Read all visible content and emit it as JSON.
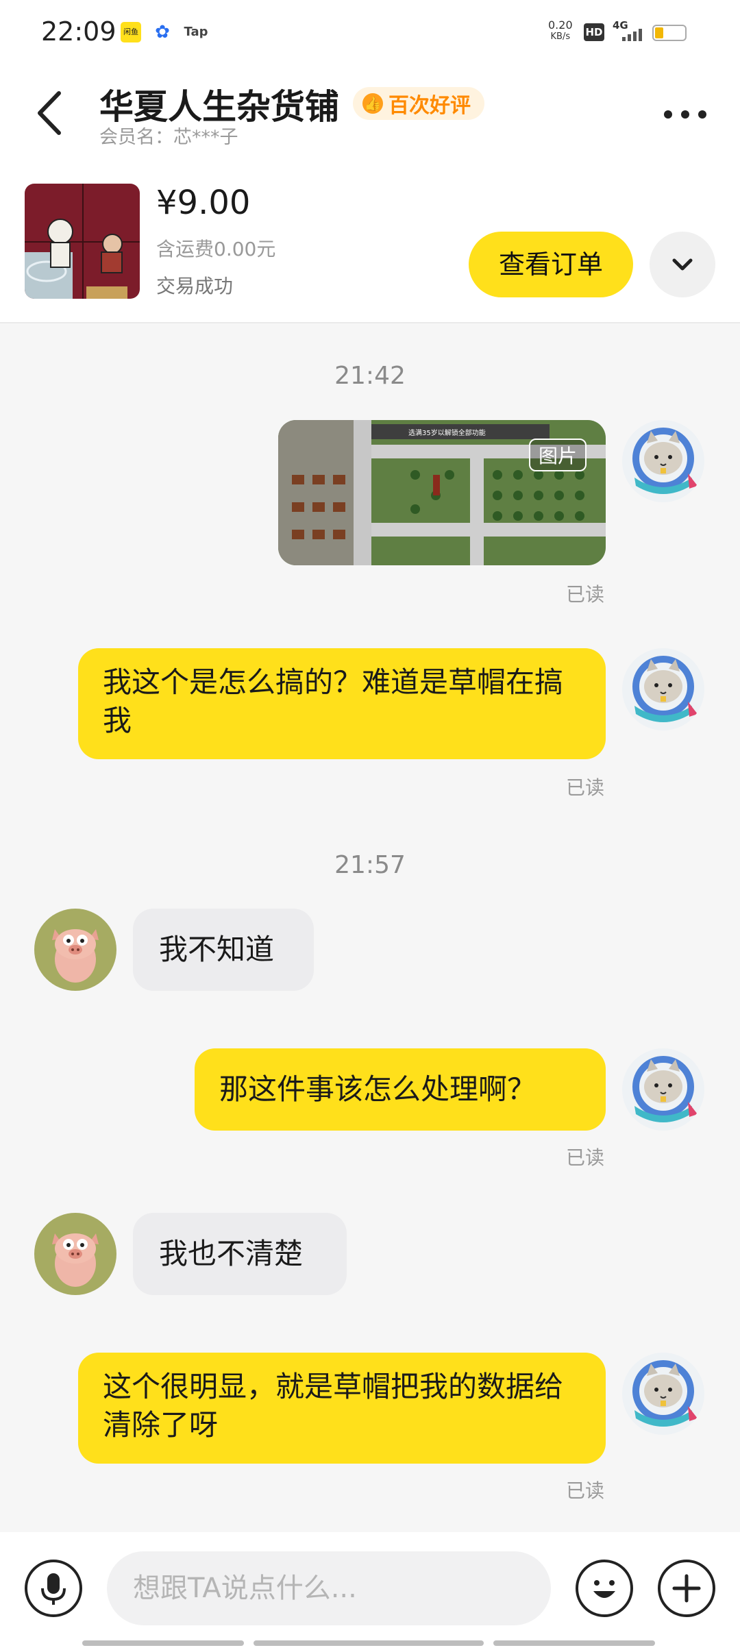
{
  "status_bar": {
    "time": "22:09",
    "apps": [
      "闲鱼",
      "百度",
      "Tap"
    ],
    "speed_value": "0.20",
    "speed_unit": "KB/s",
    "hd": "HD",
    "network": "4G"
  },
  "header": {
    "shop_name": "华夏人生杂货铺",
    "rating_badge": "百次好评",
    "member_label": "会员名：芯***子"
  },
  "product": {
    "price": "¥9.00",
    "shipping": "含运费0.00元",
    "status": "交易成功",
    "order_button": "查看订单"
  },
  "chat": {
    "timestamps": [
      "21:42",
      "21:57"
    ],
    "image_label": "图片",
    "image_caption": "选满35岁以解锁全部功能",
    "read_label": "已读",
    "messages": [
      {
        "from": "me",
        "text": "我这个是怎么搞的？难道是草帽在搞我"
      },
      {
        "from": "other",
        "text": "我不知道"
      },
      {
        "from": "me",
        "text": "那这件事该怎么处理啊？"
      },
      {
        "from": "other",
        "text": "我也不清楚"
      },
      {
        "from": "me",
        "text": "这个很明显，就是草帽把我的数据给清除了呀"
      }
    ]
  },
  "input": {
    "placeholder": "想跟TA说点什么..."
  },
  "colors": {
    "accent": "#ffe01b",
    "rating": "#ff8a00",
    "bubble_other": "#ececee"
  },
  "icons": [
    "back-icon",
    "more-icon",
    "chevron-down-icon",
    "mic-icon",
    "emoji-icon",
    "plus-icon"
  ]
}
